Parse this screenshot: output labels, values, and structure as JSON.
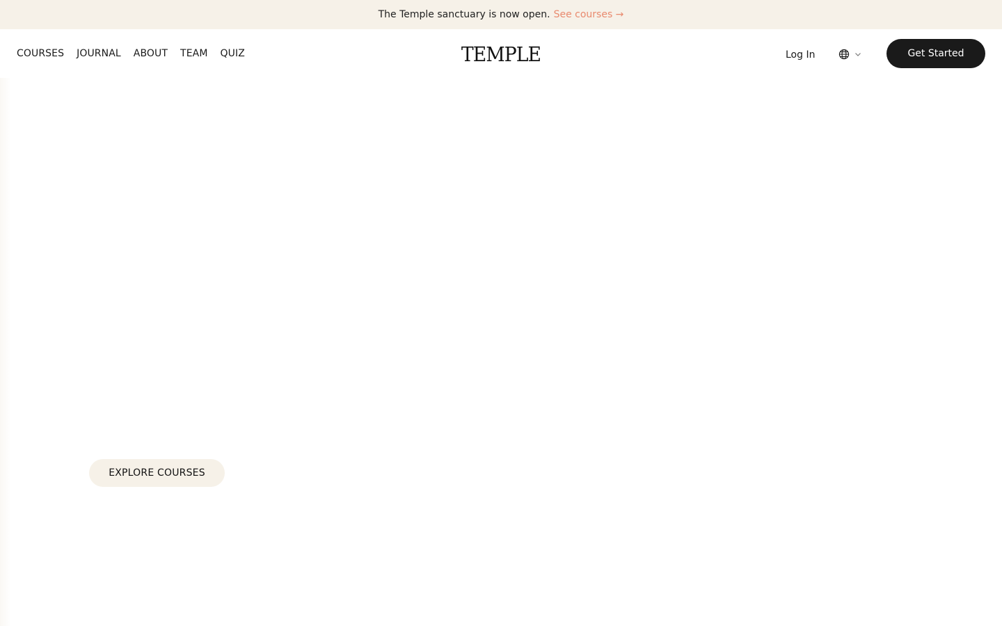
{
  "announcement": {
    "text": "The Temple sanctuary is now open.",
    "link_label": "See courses →"
  },
  "header": {
    "nav": [
      "COURSES",
      "JOURNAL",
      "ABOUT",
      "TEAM",
      "QUIZ"
    ],
    "logo": "TEMPLE",
    "login_label": "Log In",
    "language_icon": "globe-icon",
    "language_chevron_icon": "chevron-down-icon",
    "cta_label": "Get Started"
  },
  "hero": {
    "cta_label": "EXPLORE COURSES"
  },
  "colors": {
    "announcement_bg": "#f6f1e8",
    "link_accent": "#e98a6e",
    "primary_dark": "#1a1a1a",
    "cream_button": "#f6f1e8"
  }
}
